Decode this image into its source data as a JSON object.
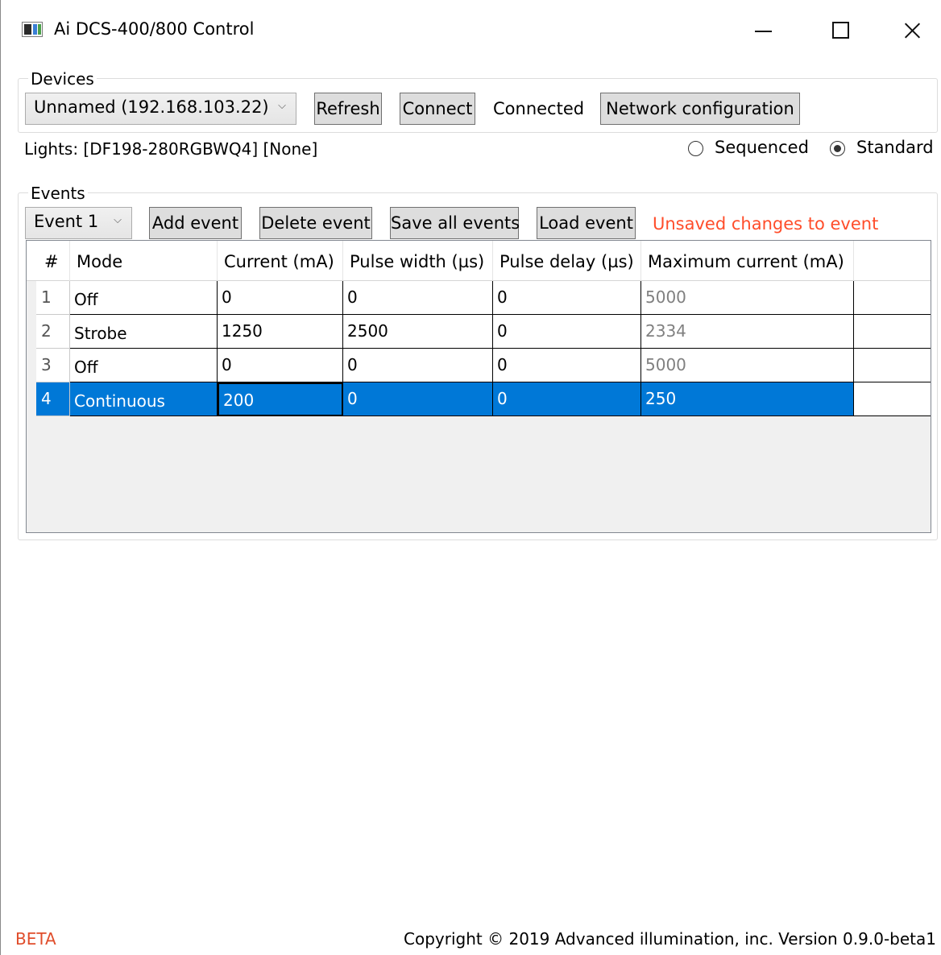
{
  "window": {
    "title": "Ai DCS-400/800 Control"
  },
  "devices": {
    "legend": "Devices",
    "selected_device": "Unnamed (192.168.103.22)",
    "refresh_label": "Refresh",
    "connect_label": "Connect",
    "status": "Connected",
    "network_config_label": "Network configuration"
  },
  "lights": {
    "text": "Lights: [DF198-280RGBWQ4] [None]"
  },
  "mode_options": {
    "sequenced_label": "Sequenced",
    "standard_label": "Standard",
    "selected": "Standard"
  },
  "events": {
    "legend": "Events",
    "selected_event": "Event 1",
    "add_label": "Add event",
    "delete_label": "Delete event",
    "save_all_label": "Save all events",
    "load_label": "Load event",
    "unsaved_message": "Unsaved changes to event"
  },
  "table": {
    "headers": [
      "#",
      "Mode",
      "Current (mA)",
      "Pulse width (µs)",
      "Pulse delay (µs)",
      "Maximum current (mA)"
    ],
    "rows": [
      {
        "num": "1",
        "mode": "Off",
        "current": "0",
        "pulse_width": "0",
        "pulse_delay": "0",
        "max_current": "5000"
      },
      {
        "num": "2",
        "mode": "Strobe",
        "current": "1250",
        "pulse_width": "2500",
        "pulse_delay": "0",
        "max_current": "2334"
      },
      {
        "num": "3",
        "mode": "Off",
        "current": "0",
        "pulse_width": "0",
        "pulse_delay": "0",
        "max_current": "5000"
      },
      {
        "num": "4",
        "mode": "Continuous",
        "current": "200",
        "pulse_width": "0",
        "pulse_delay": "0",
        "max_current": "250"
      }
    ],
    "selected_row": "4"
  },
  "footer": {
    "beta": "BETA",
    "copyright": "Copyright © 2019 Advanced illumination, inc. Version 0.9.0-beta1"
  },
  "colors": {
    "selection": "#0078d7",
    "warning": "#ff4d2a",
    "beta": "#e04d2b"
  }
}
